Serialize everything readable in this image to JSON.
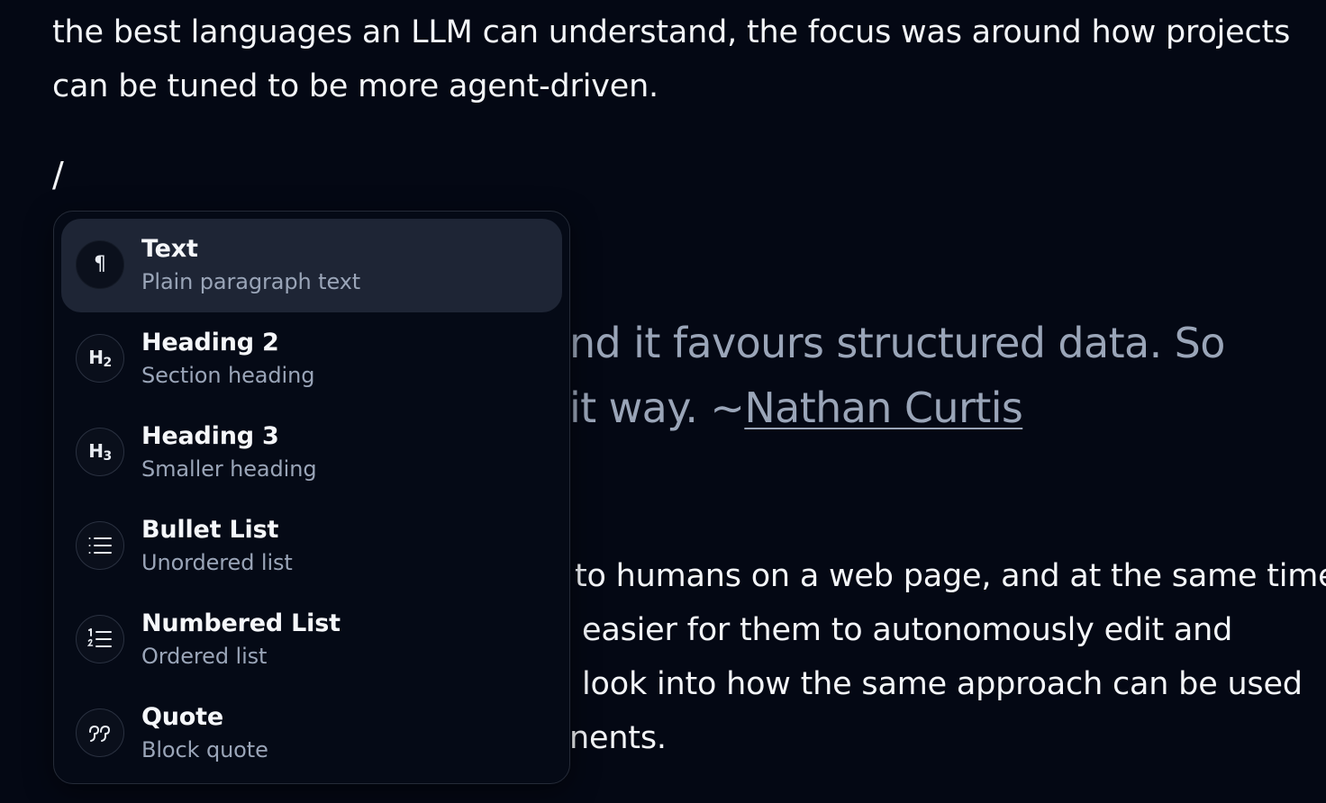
{
  "document": {
    "intro_lines": [
      "the best languages an LLM can understand, the focus was around how projects",
      "can be tuned to be more agent-driven."
    ],
    "slash_input": "/",
    "quote_lines": [
      "nd it favours structured data. So",
      "it way. ~"
    ],
    "quote_author_link": "Nathan Curtis",
    "body_lines": [
      "to humans on a web page, and at the same time",
      "easier for them to autonomously edit and",
      "look into how the same approach can be used",
      "nents."
    ]
  },
  "slash_menu": {
    "items": [
      {
        "title": "Text",
        "description": "Plain paragraph text",
        "icon": "pilcrow-icon",
        "glyph": "¶",
        "active": true
      },
      {
        "title": "Heading 2",
        "description": "Section heading",
        "icon": "heading-2-icon",
        "glyph": "H",
        "glyph_sub": "2",
        "active": false
      },
      {
        "title": "Heading 3",
        "description": "Smaller heading",
        "icon": "heading-3-icon",
        "glyph": "H",
        "glyph_sub": "3",
        "active": false
      },
      {
        "title": "Bullet List",
        "description": "Unordered list",
        "icon": "bullet-list-icon",
        "active": false
      },
      {
        "title": "Numbered List",
        "description": "Ordered list",
        "icon": "numbered-list-icon",
        "active": false
      },
      {
        "title": "Quote",
        "description": "Block quote",
        "icon": "quote-icon",
        "active": false
      }
    ]
  },
  "colors": {
    "background": "#040814",
    "text": "#f3f5f8",
    "muted": "#9aa5b8",
    "menu_active": "#1e2535",
    "menu_border": "#252b38"
  }
}
